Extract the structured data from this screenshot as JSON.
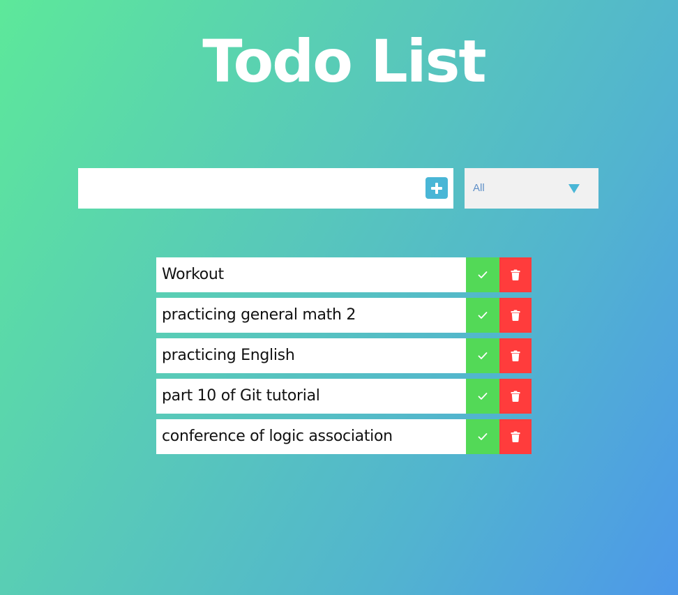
{
  "header": {
    "title": "Todo List"
  },
  "add_form": {
    "input_value": "",
    "input_placeholder": "",
    "add_icon": "plus-icon"
  },
  "filter": {
    "selected": "All",
    "options": [
      "All"
    ],
    "arrow_icon": "caret-down-icon"
  },
  "todos": [
    {
      "text": "Workout",
      "complete_icon": "check-icon",
      "delete_icon": "trash-icon"
    },
    {
      "text": "practicing general math 2",
      "complete_icon": "check-icon",
      "delete_icon": "trash-icon"
    },
    {
      "text": "practicing English",
      "complete_icon": "check-icon",
      "delete_icon": "trash-icon"
    },
    {
      "text": "part 10 of Git tutorial",
      "complete_icon": "check-icon",
      "delete_icon": "trash-icon"
    },
    {
      "text": "conference of logic association",
      "complete_icon": "check-icon",
      "delete_icon": "trash-icon"
    }
  ],
  "colors": {
    "background_start": "#5de89a",
    "background_end": "#4d98e9",
    "accent": "#49b6d6",
    "complete": "#53d957",
    "delete": "#ff3c3c",
    "filter_text": "#5e8fc7"
  }
}
